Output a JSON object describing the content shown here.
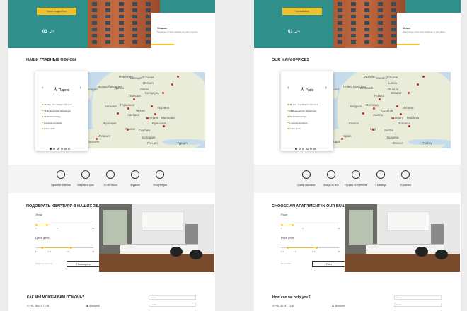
{
  "panels": [
    {
      "id": "ru",
      "hero": {
        "sub": "",
        "button": "Узнать подробнее",
        "page_current": "01",
        "page_next": "04",
        "card_title": "Фишки",
        "card_sub": "Разделы лучших зданий все раз и купите"
      },
      "offices_title": "НАШИ ГЛАВНЫЕ ОФИСЫ",
      "city": "Париж",
      "addresses": [
        "45, Ave. des Champs-Élysées",
        "78 Boulevard de Sébastopol",
        "29-34 Rohrachtge",
        "1 avenue du Gloria",
        "1 Rue of Air"
      ],
      "map_labels": [
        "Эстония",
        "Латвия",
        "Литва",
        "Беларусь",
        "Польша",
        "Германия",
        "Украина",
        "Франция",
        "Румыния",
        "Италия",
        "Испания",
        "Турция",
        "Болгария",
        "Норвегия",
        "Швеция",
        "Дания",
        "Ирландия",
        "Великобритания",
        "Чехия",
        "Австрия",
        "Сербия",
        "Венгрия",
        "Молдова",
        "Бельгия",
        "Греция",
        "Португалия"
      ],
      "features": [
        "Гарантия качества",
        "Вовремя в срок",
        "15 лет опыта",
        "8 зданий",
        "30 партнеров"
      ],
      "finder_title": "ПОДОБРАТЬ КВАРТИРУ В НАШИХ ЗДАНИЯХ",
      "floor_label": "Этаж",
      "floor_ticks": [
        "1",
        "3",
        "12"
      ],
      "price_label": "Цена (млн)",
      "price_ticks": [
        "1.0",
        "1.0",
        "1.0",
        "30"
      ],
      "reset": "Сбросить фильтр",
      "search": "Посмотреть",
      "contact_title": "КАК МЫ МОЖЕМ ВАМ ПОМОЧЬ?",
      "phone": "+91 38 447 73 58",
      "social": "@solynhl",
      "fields": [
        "Name",
        "Email",
        "Phone"
      ]
    },
    {
      "id": "en",
      "hero": {
        "sub": "",
        "button": "Consultation",
        "page_current": "01",
        "page_next": "04",
        "card_title": "Grace",
        "card_sub": "Wide range of the best buildings in one place"
      },
      "offices_title": "OUR MAIN OFFICES",
      "city": "Paris",
      "addresses": [
        "45, Ave. des Champs-Élysées",
        "78 Boulevard de Sébastopol",
        "29-34 Rohrachtge",
        "1 avenue du Gloria",
        "1 Rue of Air"
      ],
      "map_labels": [
        "Estonia",
        "Latvia",
        "Lithuania",
        "Belarus",
        "Poland",
        "Germany",
        "Ukraine",
        "France",
        "Romania",
        "Italy",
        "Spain",
        "Turkey",
        "Bulgaria",
        "Norway",
        "Sweden",
        "Denmark",
        "Ireland",
        "United Kingdom",
        "Czechia",
        "Austria",
        "Serbia",
        "Hungary",
        "Moldova",
        "Belgium",
        "Greece",
        "Portugal"
      ],
      "features": [
        "Quality assurance",
        "Always on time",
        "15 years of experience",
        "8 buildings",
        "20 partners"
      ],
      "finder_title": "CHOOSE AN APARTMENT IN OUR BUILDINGS",
      "floor_label": "Floor",
      "floor_ticks": [
        "1",
        "3",
        "12"
      ],
      "price_label": "Price (mln)",
      "price_ticks": [
        "1.0",
        "1.0",
        "1.0",
        "30"
      ],
      "reset": "Reset filter",
      "search": "Filter",
      "contact_title": "How can we help you?",
      "phone": "+91 38 447 73 58",
      "social": "@solynhl",
      "fields": [
        "Name",
        "Email",
        "Phone"
      ]
    }
  ],
  "colors": {
    "accent": "#f2c22c",
    "hero_sky": "#2f8f8a",
    "map_water": "#c6dcec",
    "map_land": "#e9ecd8",
    "pin": "#c92d2d"
  },
  "icons": [
    "quality-icon",
    "clock-icon",
    "experience-icon",
    "building-icon",
    "handshake-icon"
  ],
  "slider_values": {
    "floor_min": 1,
    "floor_max": 3,
    "price_min_fraction": 0.1,
    "price_max_fraction": 0.6
  }
}
